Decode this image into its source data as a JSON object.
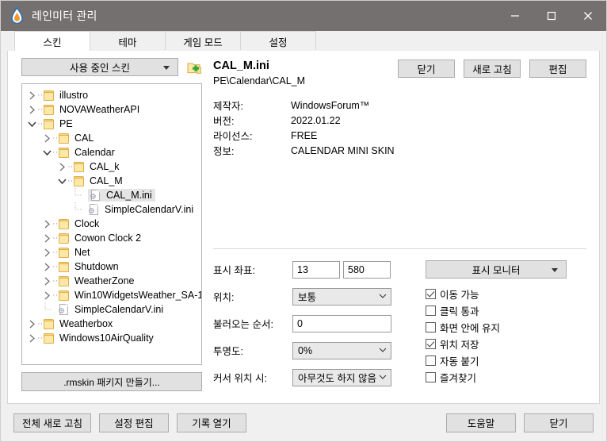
{
  "window": {
    "title": "레인미터 관리",
    "icon": "raindrop-icon",
    "controls": {
      "minimize": "minimize-icon",
      "maximize": "maximize-icon",
      "close": "close-icon"
    }
  },
  "tabs": [
    {
      "label": "스킨",
      "active": true
    },
    {
      "label": "테마",
      "active": false
    },
    {
      "label": "게임 모드",
      "active": false
    },
    {
      "label": "설정",
      "active": false
    }
  ],
  "left": {
    "skin_filter": "사용 중인 스킨",
    "add_skin_icon": "add-folder-icon",
    "package_button": ".rmskin 패키지 만들기...",
    "tree": [
      {
        "label": "illustro",
        "type": "folder",
        "depth": 0,
        "state": "collapsed",
        "selected": false
      },
      {
        "label": "NOVAWeatherAPI",
        "type": "folder",
        "depth": 0,
        "state": "collapsed",
        "selected": false
      },
      {
        "label": "PE",
        "type": "folder",
        "depth": 0,
        "state": "expanded",
        "selected": false
      },
      {
        "label": "CAL",
        "type": "folder",
        "depth": 1,
        "state": "collapsed",
        "selected": false
      },
      {
        "label": "Calendar",
        "type": "folder",
        "depth": 1,
        "state": "expanded",
        "selected": false
      },
      {
        "label": "CAL_k",
        "type": "folder",
        "depth": 2,
        "state": "collapsed",
        "selected": false
      },
      {
        "label": "CAL_M",
        "type": "folder",
        "depth": 2,
        "state": "expanded",
        "selected": false
      },
      {
        "label": "CAL_M.ini",
        "type": "file",
        "depth": 3,
        "state": "leaf",
        "selected": true
      },
      {
        "label": "SimpleCalendarV.ini",
        "type": "file",
        "depth": 3,
        "state": "leaf",
        "selected": false
      },
      {
        "label": "Clock",
        "type": "folder",
        "depth": 1,
        "state": "collapsed",
        "selected": false
      },
      {
        "label": "Cowon Clock 2",
        "type": "folder",
        "depth": 1,
        "state": "collapsed",
        "selected": false
      },
      {
        "label": "Net",
        "type": "folder",
        "depth": 1,
        "state": "collapsed",
        "selected": false
      },
      {
        "label": "Shutdown",
        "type": "folder",
        "depth": 1,
        "state": "collapsed",
        "selected": false
      },
      {
        "label": "WeatherZone",
        "type": "folder",
        "depth": 1,
        "state": "collapsed",
        "selected": false
      },
      {
        "label": "Win10WidgetsWeather_SA-1",
        "type": "folder",
        "depth": 1,
        "state": "collapsed",
        "selected": false
      },
      {
        "label": "SimpleCalendarV.ini",
        "type": "file",
        "depth": 1,
        "state": "leaf",
        "selected": false
      },
      {
        "label": "Weatherbox",
        "type": "folder",
        "depth": 0,
        "state": "collapsed",
        "selected": false
      },
      {
        "label": "Windows10AirQuality",
        "type": "folder",
        "depth": 0,
        "state": "collapsed",
        "selected": false
      }
    ]
  },
  "detail": {
    "skin_name": "CAL_M.ini",
    "skin_path": "PE\\Calendar\\CAL_M",
    "buttons": {
      "close": "닫기",
      "refresh": "새로 고침",
      "edit": "편집"
    },
    "fields": [
      {
        "key": "제작자:",
        "value": "WindowsForum™"
      },
      {
        "key": "버전:",
        "value": "2022.01.22"
      },
      {
        "key": "라이선스:",
        "value": "FREE"
      },
      {
        "key": "정보:",
        "value": "CALENDAR MINI SKIN"
      }
    ]
  },
  "settings": {
    "coords_label": "표시 좌표:",
    "coord_x": "13",
    "coord_y": "580",
    "position_label": "위치:",
    "position_value": "보통",
    "load_order_label": "불러오는 순서:",
    "load_order_value": "0",
    "transparency_label": "투명도:",
    "transparency_value": "0%",
    "hover_label": "커서 위치 시:",
    "hover_value": "아무것도 하지 않음",
    "monitor_button": "표시 모니터",
    "checkboxes": [
      {
        "label": "이동 가능",
        "checked": true
      },
      {
        "label": "클릭 통과",
        "checked": false
      },
      {
        "label": "화면 안에 유지",
        "checked": false
      },
      {
        "label": "위치 저장",
        "checked": true
      },
      {
        "label": "자동 붙기",
        "checked": false
      },
      {
        "label": "즐겨찾기",
        "checked": false
      }
    ]
  },
  "bottom": {
    "refresh_all": "전체 새로 고침",
    "edit_settings": "설정 편집",
    "open_log": "기록 열기",
    "help": "도움말",
    "close": "닫기"
  },
  "colors": {
    "titlebar": "#757070",
    "accent_folder": "#fde8a8",
    "button_face": "#e1e1e1",
    "selection": "#e4e4e4"
  }
}
